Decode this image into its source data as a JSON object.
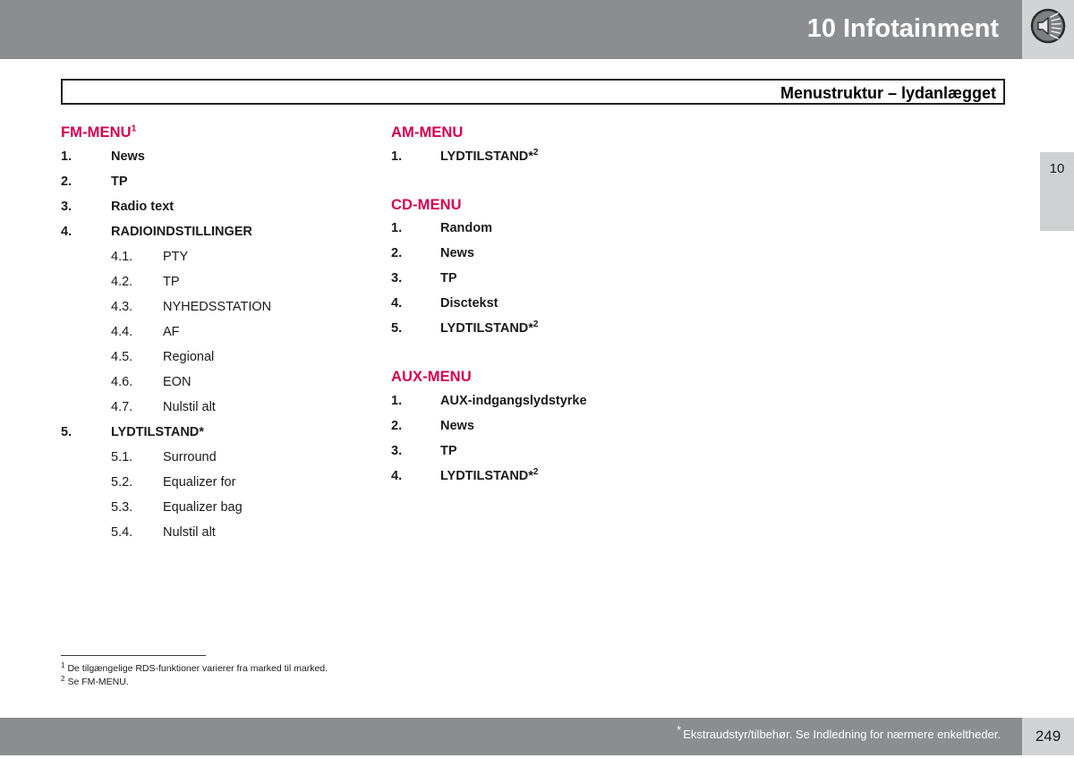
{
  "header": {
    "chapter_title": "10 Infotainment",
    "icon": "speaker-sound-icon",
    "band_color": "#8c8d91",
    "icon_box_color": "#d2d3d5"
  },
  "title_box": {
    "text": "Menustruktur – lydanlægget"
  },
  "chapter_tab": {
    "number": "10"
  },
  "accent_color": "#d4004f",
  "columns": {
    "left": [
      {
        "heading": "FM-MENU",
        "heading_sup": "1",
        "items": [
          {
            "level": 1,
            "num": "1.",
            "label": "News"
          },
          {
            "level": 1,
            "num": "2.",
            "label": "TP"
          },
          {
            "level": 1,
            "num": "3.",
            "label": "Radio text"
          },
          {
            "level": 1,
            "num": "4.",
            "label": "RADIOINDSTILLINGER"
          },
          {
            "level": 2,
            "num": "4.1.",
            "label": "PTY"
          },
          {
            "level": 2,
            "num": "4.2.",
            "label": "TP"
          },
          {
            "level": 2,
            "num": "4.3.",
            "label": "NYHEDSSTATION"
          },
          {
            "level": 2,
            "num": "4.4.",
            "label": "AF"
          },
          {
            "level": 2,
            "num": "4.5.",
            "label": "Regional"
          },
          {
            "level": 2,
            "num": "4.6.",
            "label": "EON"
          },
          {
            "level": 2,
            "num": "4.7.",
            "label": "Nulstil alt"
          },
          {
            "level": 1,
            "num": "5.",
            "label": "LYDTILSTAND*"
          },
          {
            "level": 2,
            "num": "5.1.",
            "label": "Surround"
          },
          {
            "level": 2,
            "num": "5.2.",
            "label": "Equalizer for"
          },
          {
            "level": 2,
            "num": "5.3.",
            "label": "Equalizer bag"
          },
          {
            "level": 2,
            "num": "5.4.",
            "label": "Nulstil alt"
          }
        ]
      }
    ],
    "right": [
      {
        "heading": "AM-MENU",
        "heading_sup": "",
        "items": [
          {
            "level": 1,
            "num": "1.",
            "label": "LYDTILSTAND*",
            "sup": "2"
          }
        ]
      },
      {
        "heading": "CD-MENU",
        "heading_sup": "",
        "items": [
          {
            "level": 1,
            "num": "1.",
            "label": "Random"
          },
          {
            "level": 1,
            "num": "2.",
            "label": "News"
          },
          {
            "level": 1,
            "num": "3.",
            "label": "TP"
          },
          {
            "level": 1,
            "num": "4.",
            "label": "Disctekst"
          },
          {
            "level": 1,
            "num": "5.",
            "label": "LYDTILSTAND*",
            "sup": "2"
          }
        ]
      },
      {
        "heading": "AUX-MENU",
        "heading_sup": "",
        "items": [
          {
            "level": 1,
            "num": "1.",
            "label": "AUX-indgangslydstyrke"
          },
          {
            "level": 1,
            "num": "2.",
            "label": "News"
          },
          {
            "level": 1,
            "num": "3.",
            "label": "TP"
          },
          {
            "level": 1,
            "num": "4.",
            "label": "LYDTILSTAND*",
            "sup": "2"
          }
        ]
      }
    ]
  },
  "footnotes": [
    {
      "mark": "1",
      "text": "De tilgængelige RDS-funktioner varierer fra marked til marked."
    },
    {
      "mark": "2",
      "text": "Se FM-MENU."
    }
  ],
  "footer": {
    "star": "*",
    "note": "Ekstraudstyr/tilbehør. Se Indledning for nærmere enkeltheder.",
    "page_number": "249"
  }
}
